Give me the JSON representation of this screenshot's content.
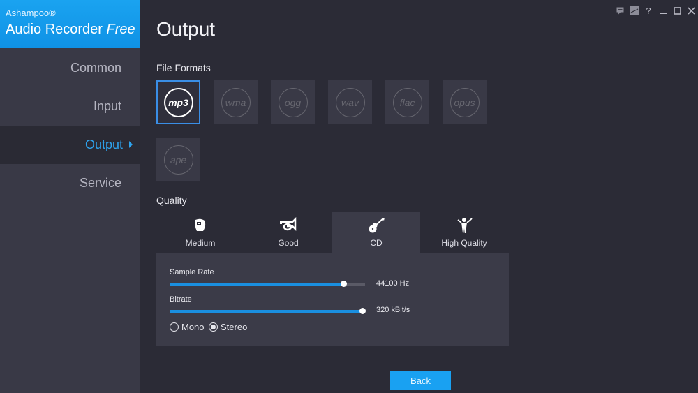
{
  "app": {
    "brand_small": "Ashampoo®",
    "brand_name": "Audio Recorder ",
    "brand_edition": "Free"
  },
  "window_controls": [
    {
      "name": "feedback-icon",
      "glyph": "▣"
    },
    {
      "name": "edit-icon",
      "glyph": "▨"
    },
    {
      "name": "help-icon",
      "glyph": "?"
    },
    {
      "name": "minimize-icon",
      "glyph": "—"
    },
    {
      "name": "maximize-icon",
      "glyph": "☐"
    },
    {
      "name": "close-icon",
      "glyph": "✕"
    }
  ],
  "sidebar": {
    "items": [
      {
        "label": "Common",
        "active": false
      },
      {
        "label": "Input",
        "active": false
      },
      {
        "label": "Output",
        "active": true
      },
      {
        "label": "Service",
        "active": false
      }
    ]
  },
  "page": {
    "title": "Output",
    "file_formats_label": "File Formats",
    "quality_label": "Quality"
  },
  "formats": [
    {
      "label": "mp3",
      "selected": true
    },
    {
      "label": "wma",
      "selected": false
    },
    {
      "label": "ogg",
      "selected": false
    },
    {
      "label": "wav",
      "selected": false
    },
    {
      "label": "flac",
      "selected": false
    },
    {
      "label": "opus",
      "selected": false
    },
    {
      "label": "ape",
      "selected": false
    }
  ],
  "quality_tabs": [
    {
      "label": "Medium",
      "icon": "tape-icon",
      "active": false
    },
    {
      "label": "Good",
      "icon": "horn-icon",
      "active": false
    },
    {
      "label": "CD",
      "icon": "guitar-icon",
      "active": true
    },
    {
      "label": "High Quality",
      "icon": "conductor-icon",
      "active": false
    }
  ],
  "settings": {
    "sample_rate_label": "Sample Rate",
    "sample_rate_value": "44100 Hz",
    "sample_rate_fraction": 0.89,
    "bitrate_label": "Bitrate",
    "bitrate_value": "320 kBit/s",
    "bitrate_fraction": 1.0,
    "channels": [
      {
        "label": "Mono",
        "checked": false
      },
      {
        "label": "Stereo",
        "checked": true
      }
    ]
  },
  "footer": {
    "back_label": "Back"
  },
  "colors": {
    "accent": "#1aa3f0",
    "slider_fill": "#1a8fe0",
    "selected_border": "#3a8ee6"
  }
}
